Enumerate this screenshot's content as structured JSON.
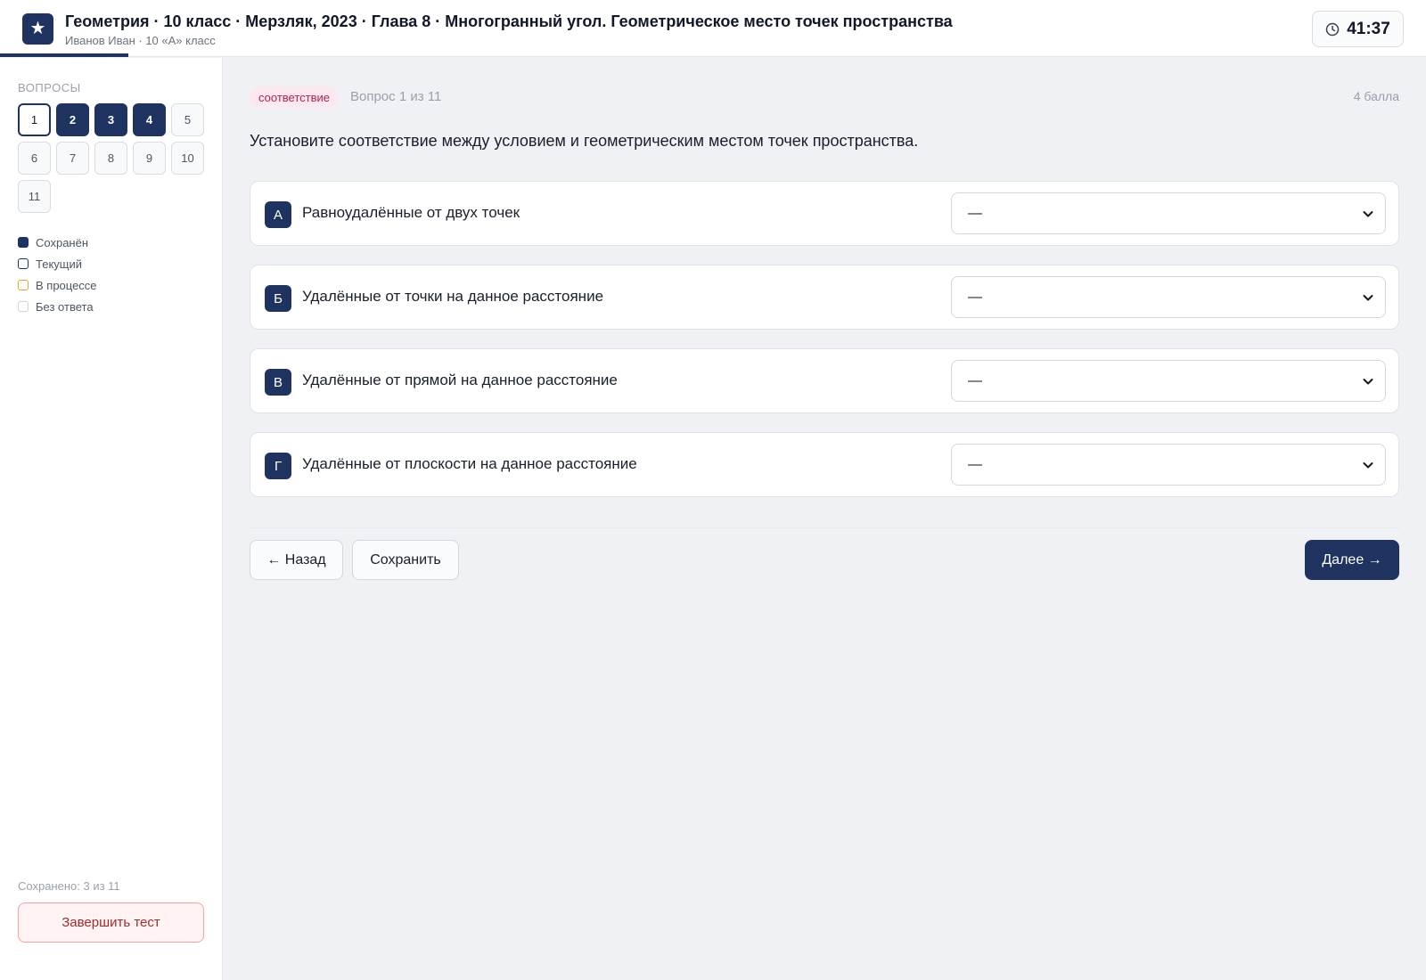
{
  "header": {
    "logo_glyph": "★",
    "title": "Геометрия · 10 класс · Мерзляк, 2023 · Глава 8 · Многогранный угол. Геометрическое место точек пространства",
    "subtitle": "Иванов Иван · 10 «А» класс",
    "timer": "41:37",
    "timer_icon": "clock-icon"
  },
  "sidebar": {
    "heading": "ВОПРОСЫ",
    "questions": [
      {
        "label": "1",
        "state": "current"
      },
      {
        "label": "2",
        "state": "saved"
      },
      {
        "label": "3",
        "state": "saved"
      },
      {
        "label": "4",
        "state": "saved"
      },
      {
        "label": "5",
        "state": "none"
      },
      {
        "label": "6",
        "state": "none"
      },
      {
        "label": "7",
        "state": "none"
      },
      {
        "label": "8",
        "state": "none"
      },
      {
        "label": "9",
        "state": "none"
      },
      {
        "label": "10",
        "state": "none"
      },
      {
        "label": "11",
        "state": "none"
      }
    ],
    "legend": {
      "saved": "Сохранён",
      "current": "Текущий",
      "in_progress": "В процессе",
      "no_answer": "Без ответа"
    },
    "saved_count": "Сохранено: 3 из 11",
    "finish_label": "Завершить тест"
  },
  "main": {
    "tag": "соответствие",
    "question_number": "Вопрос 1 из 11",
    "points": "4 балла",
    "question_text": "Установите соответствие между условием и геометрическим местом точек пространства.",
    "rows": [
      {
        "letter": "А",
        "text": "Равноудалённые от двух точек",
        "selected": "—"
      },
      {
        "letter": "Б",
        "text": "Удалённые от точки на данное расстояние",
        "selected": "—"
      },
      {
        "letter": "В",
        "text": "Удалённые от прямой на данное расстояние",
        "selected": "—"
      },
      {
        "letter": "Г",
        "text": "Удалённые от плоскости на данное расстояние",
        "selected": "—"
      }
    ],
    "back_label": "← Назад",
    "save_label": "Сохранить",
    "next_label": "Далее →"
  },
  "colors": {
    "brand": "#1f3360",
    "tag_bg": "#fce8ef",
    "tag_text": "#b0224e",
    "finish_border": "#f4a2a2",
    "in_progress": "#e0a431"
  }
}
